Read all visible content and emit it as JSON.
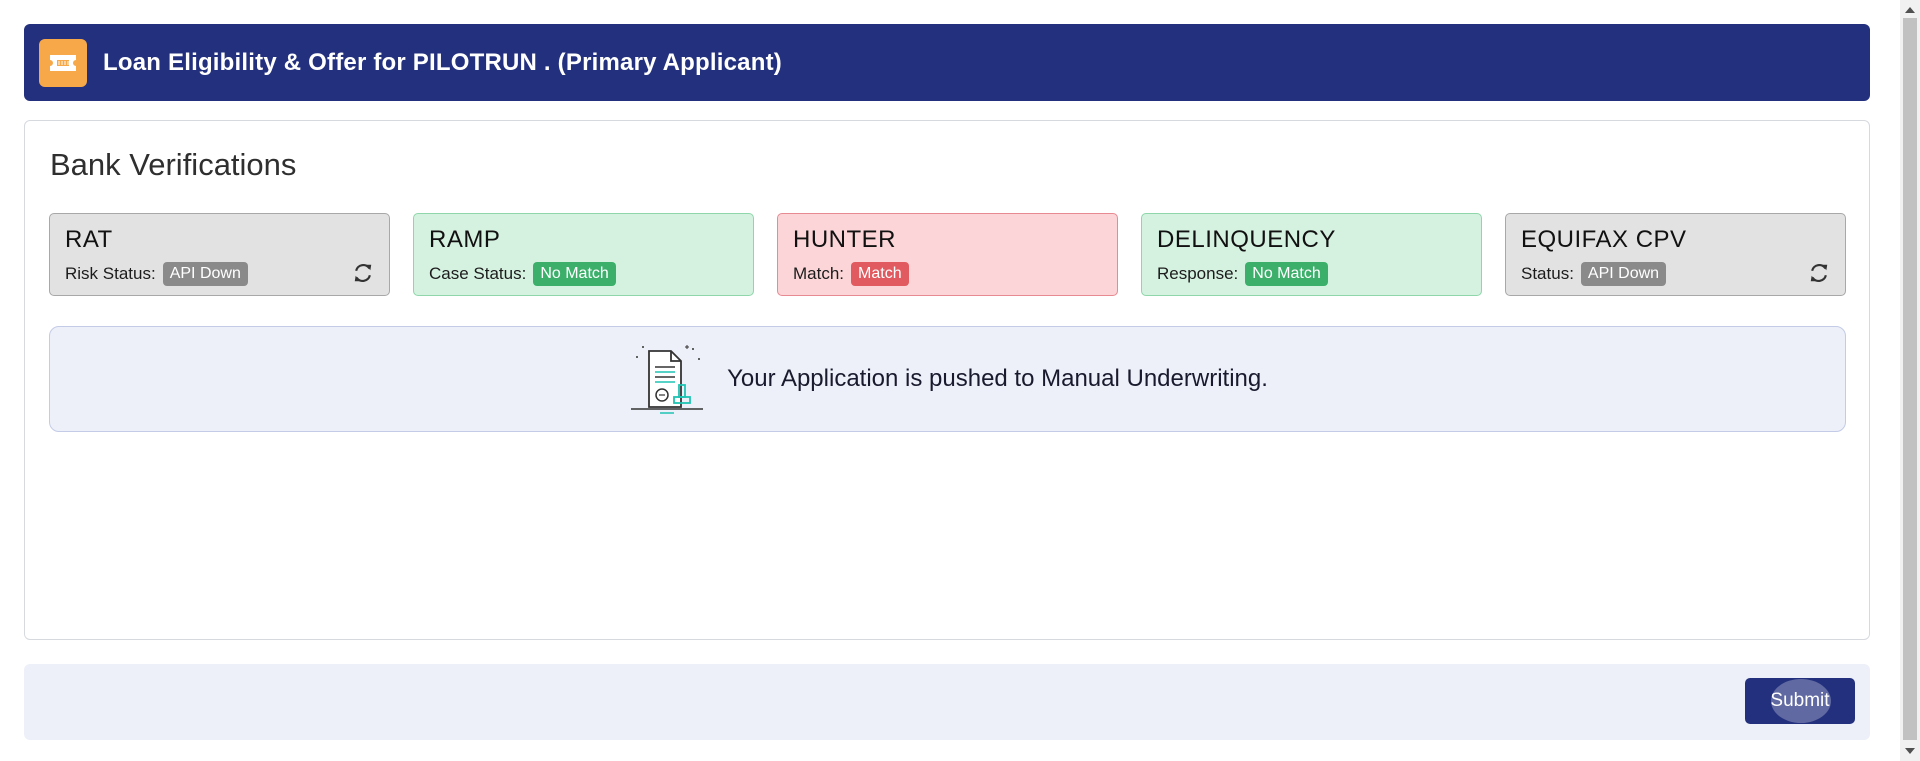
{
  "header": {
    "title": "Loan Eligibility & Offer for PILOTRUN . (Primary Applicant)",
    "icon": "ticket-icon",
    "accent_color": "#23307d",
    "icon_bg_color": "#f7a94a"
  },
  "section": {
    "title": "Bank Verifications"
  },
  "verifications": [
    {
      "title": "RAT",
      "label": "Risk Status:",
      "status": "API Down",
      "variant": "neutral",
      "badge_color": "#8a8a8a",
      "refresh": true
    },
    {
      "title": "RAMP",
      "label": "Case Status:",
      "status": "No Match",
      "variant": "success",
      "badge_color": "#3cb06b",
      "refresh": false
    },
    {
      "title": "HUNTER",
      "label": "Match:",
      "status": "Match",
      "variant": "danger",
      "badge_color": "#e05a5f",
      "refresh": false
    },
    {
      "title": "DELINQUENCY",
      "label": "Response:",
      "status": "No Match",
      "variant": "success",
      "badge_color": "#3cb06b",
      "refresh": false
    },
    {
      "title": "EQUIFAX CPV",
      "label": "Status:",
      "status": "API Down",
      "variant": "neutral",
      "badge_color": "#8a8a8a",
      "refresh": true
    }
  ],
  "notice": {
    "text": "Your Application is pushed to Manual Underwriting.",
    "icon": "document-stamp-icon"
  },
  "footer": {
    "submit_label": "Submit"
  }
}
